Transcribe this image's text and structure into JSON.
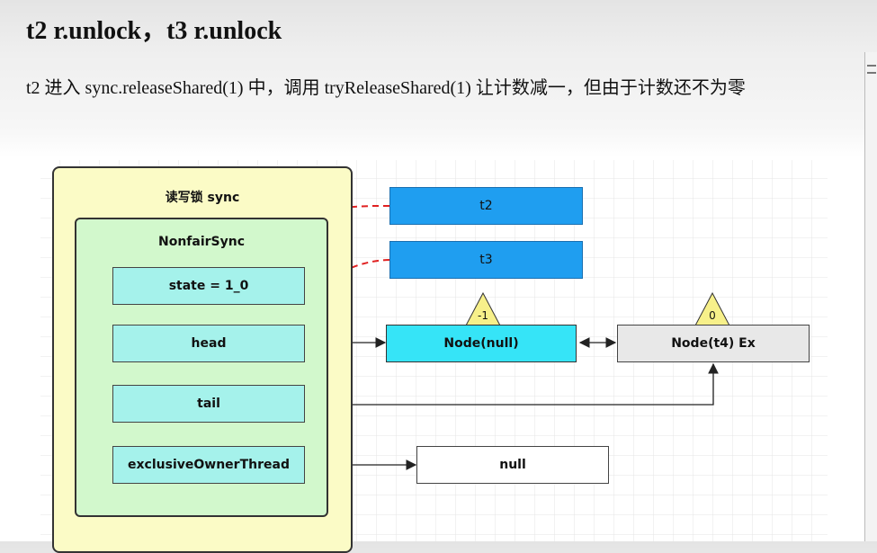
{
  "title": "t2 r.unlock，t3 r.unlock",
  "description": "t2 进入 sync.releaseShared(1) 中，调用 tryReleaseShared(1) 让计数减一，但由于计数还不为零",
  "diagram": {
    "outer_label": "读写锁 sync",
    "inner_label": "NonfairSync",
    "fields": {
      "state": "state = 1_0",
      "head": "head",
      "tail": "tail",
      "owner": "exclusiveOwnerThread"
    },
    "threads": {
      "t2": "t2",
      "t3": "t3"
    },
    "nodes": {
      "node_null": "Node(null)",
      "node_null_waitstatus": "-1",
      "node_t4": "Node(t4) Ex",
      "node_t4_waitstatus": "0",
      "null_value": "null"
    },
    "colors": {
      "outer_fill": "#fbfbc6",
      "inner_fill": "#d2f8cc",
      "field_fill": "#a5f2eb",
      "thread_fill": "#1f9ef0",
      "node_null_fill": "#36e4f7",
      "node_t4_fill": "#e8e8e8",
      "triangle_fill": "#f7f08a",
      "dashed_arrow": "#e02020"
    }
  }
}
